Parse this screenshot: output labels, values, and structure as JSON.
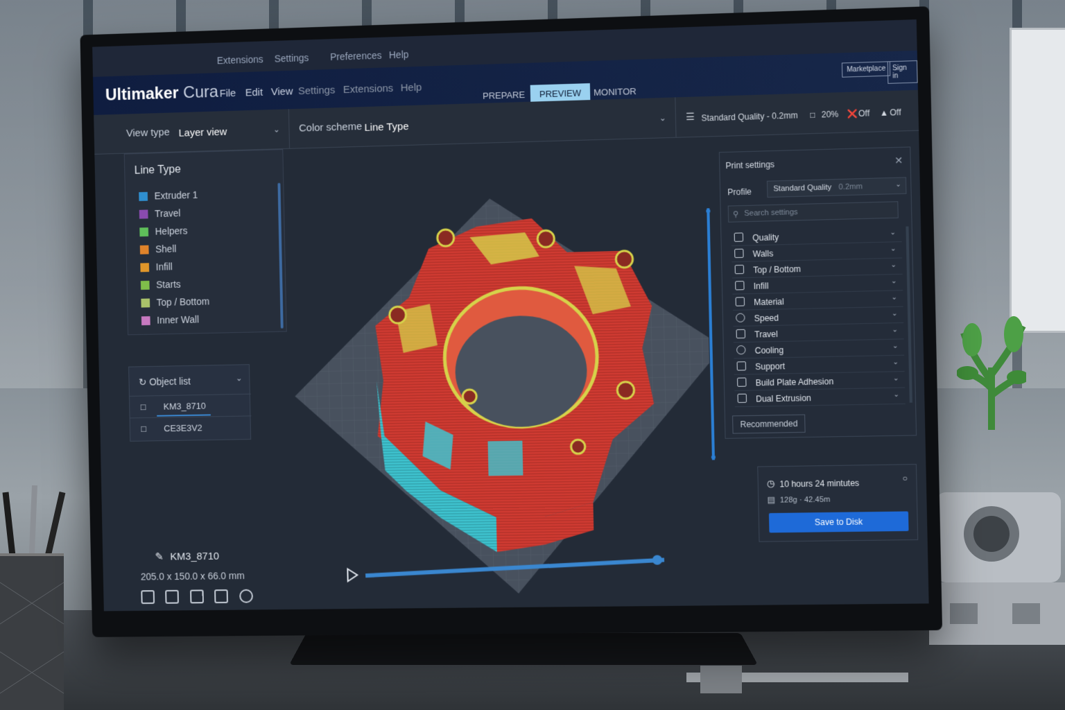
{
  "topmenu": [
    "Extensions",
    "Settings",
    "Preferences",
    "Help"
  ],
  "header": {
    "logo_brand": "Ultimaker",
    "logo_product": "Cura",
    "menu": [
      "File",
      "Edit",
      "View",
      "Settings",
      "Extensions",
      "Help"
    ],
    "stages": [
      "PREPARE",
      "PREVIEW",
      "MONITOR"
    ],
    "active_stage": "PREVIEW",
    "marketplace_label": "Marketplace",
    "signin_label": "Sign in"
  },
  "toolbar": {
    "view_type_label": "View type",
    "view_type_value": "Layer view",
    "color_scheme_label": "Color scheme",
    "color_scheme_value": "Line Type",
    "quality_summary": "Standard Quality - 0.2mm",
    "infill_summary": "20%",
    "support_summary": "Off",
    "adhesion_summary": "Off"
  },
  "legend": {
    "title": "Line Type",
    "items": [
      {
        "label": "Extruder 1",
        "color": "#2f8fd0"
      },
      {
        "label": "Travel",
        "color": "#8a4bb0"
      },
      {
        "label": "Helpers",
        "color": "#5fbf5a"
      },
      {
        "label": "Shell",
        "color": "#e0832a"
      },
      {
        "label": "Infill",
        "color": "#e0962a"
      },
      {
        "label": "Starts",
        "color": "#7fbf4a"
      },
      {
        "label": "Top / Bottom",
        "color": "#a9c26a"
      },
      {
        "label": "Inner Wall",
        "color": "#c779c0"
      }
    ]
  },
  "object_list": {
    "title": "Object list",
    "objects": [
      "KM3_8710",
      "CE3E3V2"
    ]
  },
  "model": {
    "name": "KM3_8710",
    "dimensions": "205.0 x 150.0 x 66.0 mm"
  },
  "settings": {
    "title": "Print settings",
    "profile_label": "Profile",
    "profile_value": "Standard Quality",
    "profile_suffix": "0.2mm",
    "search_placeholder": "Search settings",
    "categories": [
      "Quality",
      "Walls",
      "Top / Bottom",
      "Infill",
      "Material",
      "Speed",
      "Travel",
      "Cooling",
      "Support",
      "Build Plate Adhesion",
      "Dual Extrusion"
    ],
    "recommended_label": "Recommended"
  },
  "output": {
    "print_time": "10 hours 24 mintutes",
    "material": "128g · 42.45m",
    "save_label": "Save to Disk"
  },
  "colors": {
    "accent": "#1e6ad8",
    "shell_red": "#d13b32",
    "skin_cyan": "#3fc4d0",
    "infill_yellow": "#d6d24a"
  }
}
